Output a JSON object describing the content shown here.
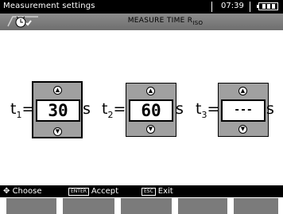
{
  "titlebar": {
    "title": "Measurement settings",
    "time": "07:39"
  },
  "header": {
    "icon": "settings-clock-icon",
    "heading": "MEASURE TIME R",
    "heading_sub": "ISO"
  },
  "times": [
    {
      "label": "t",
      "sub": "1",
      "value": "30",
      "unit": "s",
      "selected": true
    },
    {
      "label": "t",
      "sub": "2",
      "value": "60",
      "unit": "s",
      "selected": false
    },
    {
      "label": "t",
      "sub": "3",
      "value": "---",
      "unit": "s",
      "selected": false
    }
  ],
  "help": {
    "choose": "Choose",
    "enter_key": "ENTER",
    "accept": "Accept",
    "esc_key": "ESC",
    "exit": "Exit"
  },
  "colors": {
    "bar": "#000000",
    "header": "#7a7a7a",
    "box": "#a0a0a0",
    "softkey": "#7b7b7b"
  }
}
